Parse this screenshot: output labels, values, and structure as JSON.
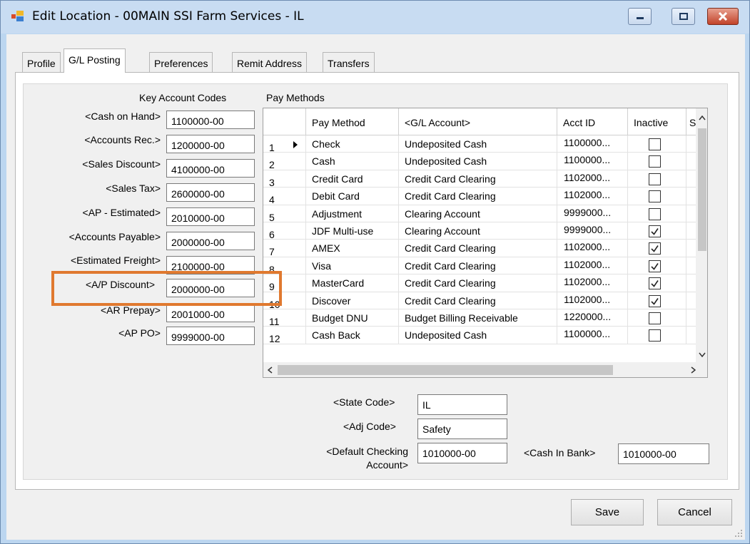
{
  "window": {
    "title": "Edit Location - 00MAIN   SSI Farm Services - IL"
  },
  "tabs": [
    {
      "label": "Profile"
    },
    {
      "label": "G/L Posting"
    },
    {
      "label": "Preferences"
    },
    {
      "label": "Remit Address"
    },
    {
      "label": "Transfers"
    }
  ],
  "key_accounts": {
    "header": "Key Account Codes",
    "fields": [
      {
        "label": "<Cash on Hand>",
        "value": "1100000-00"
      },
      {
        "label": "<Accounts Rec.>",
        "value": "1200000-00"
      },
      {
        "label": "<Sales Discount>",
        "value": "4100000-00"
      },
      {
        "label": "<Sales Tax>",
        "value": "2600000-00"
      },
      {
        "label": "<AP - Estimated>",
        "value": "2010000-00"
      },
      {
        "label": "<Accounts Payable>",
        "value": "2000000-00"
      },
      {
        "label": "<Estimated Freight>",
        "value": "2100000-00"
      },
      {
        "label": "<A/P Discount>",
        "value": "2000000-00"
      },
      {
        "label": "<AR Prepay>",
        "value": "2001000-00"
      },
      {
        "label": "<AP PO>",
        "value": "9999000-00"
      }
    ]
  },
  "pay_methods": {
    "header": "Pay Methods",
    "columns": [
      "Pay Method",
      "<G/L Account>",
      "Acct ID",
      "Inactive",
      "Su"
    ],
    "rows": [
      {
        "num": "1",
        "method": "Check",
        "account": "Undeposited Cash",
        "acct_id": "1100000...",
        "inactive": false
      },
      {
        "num": "2",
        "method": "Cash",
        "account": "Undeposited Cash",
        "acct_id": "1100000...",
        "inactive": false
      },
      {
        "num": "3",
        "method": "Credit Card",
        "account": "Credit Card Clearing",
        "acct_id": "1102000...",
        "inactive": false
      },
      {
        "num": "4",
        "method": "Debit Card",
        "account": "Credit Card Clearing",
        "acct_id": "1102000...",
        "inactive": false
      },
      {
        "num": "5",
        "method": "Adjustment",
        "account": "Clearing Account",
        "acct_id": "9999000...",
        "inactive": false
      },
      {
        "num": "6",
        "method": "JDF Multi-use",
        "account": "Clearing Account",
        "acct_id": "9999000...",
        "inactive": true
      },
      {
        "num": "7",
        "method": "AMEX",
        "account": "Credit Card Clearing",
        "acct_id": "1102000...",
        "inactive": true
      },
      {
        "num": "8",
        "method": "Visa",
        "account": "Credit Card Clearing",
        "acct_id": "1102000...",
        "inactive": true
      },
      {
        "num": "9",
        "method": "MasterCard",
        "account": "Credit Card Clearing",
        "acct_id": "1102000...",
        "inactive": true
      },
      {
        "num": "10",
        "method": "Discover",
        "account": "Credit Card Clearing",
        "acct_id": "1102000...",
        "inactive": true
      },
      {
        "num": "11",
        "method": "Budget DNU",
        "account": "Budget Billing Receivable",
        "acct_id": "1220000...",
        "inactive": false
      },
      {
        "num": "12",
        "method": "Cash Back",
        "account": "Undeposited Cash",
        "acct_id": "1100000...",
        "inactive": false
      }
    ]
  },
  "lower": {
    "state_code_label": "<State Code>",
    "state_code": "IL",
    "adj_code_label": "<Adj Code>",
    "adj_code": "Safety",
    "default_checking_label_1": "<Default Checking",
    "default_checking_label_2": "Account>",
    "default_checking": "1010000-00",
    "cash_in_bank_label": "<Cash In Bank>",
    "cash_in_bank": "1010000-00"
  },
  "buttons": {
    "save": "Save",
    "cancel": "Cancel"
  },
  "colors": {
    "highlight": "#e0792f",
    "titlebar": "#c8dcf2"
  }
}
